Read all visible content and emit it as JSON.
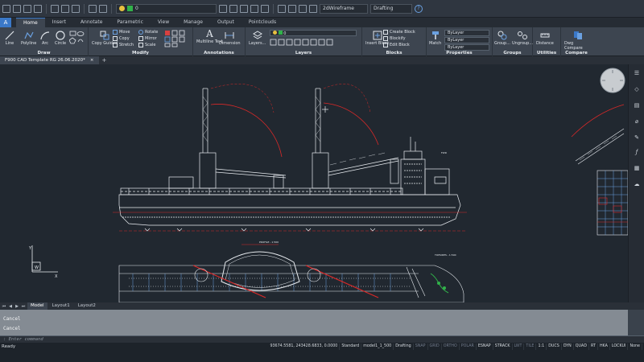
{
  "qat": {
    "layer_value": "0",
    "visual_style": "2dWireframe",
    "workspace": "Drafting"
  },
  "tabs": [
    "Home",
    "Insert",
    "Annotate",
    "Parametric",
    "View",
    "Manage",
    "Output",
    "Pointclouds"
  ],
  "ribbon": {
    "draw": {
      "title": "Draw",
      "line": "Line",
      "polyline": "Polyline",
      "arc": "Arc",
      "circle": "Circle"
    },
    "modify": {
      "title": "Modify",
      "copy_guided": "Copy Guided",
      "move": "Move",
      "copy": "Copy",
      "stretch": "Stretch",
      "rotate": "Rotate",
      "mirror": "Mirror",
      "scale": "Scale"
    },
    "annotations": {
      "title": "Annotations",
      "multiline_text": "Multiline Text",
      "dimension": "Dimension"
    },
    "layers": {
      "title": "Layers",
      "layers": "Layers...",
      "layer_value": "0"
    },
    "blocks": {
      "title": "Blocks",
      "insert_block": "Insert Block",
      "create_block": "Create Block",
      "blockify": "Blockify",
      "edit_block": "Edit Block"
    },
    "properties": {
      "title": "Properties",
      "match": "Match",
      "color": "ByLayer",
      "linetype": "ByLayer",
      "lineweight": "ByLayer"
    },
    "groups": {
      "title": "Groups",
      "group": "Group...",
      "ungroup": "Ungroup..."
    },
    "utilities": {
      "title": "Utilities",
      "distance": "Distance"
    },
    "compare": {
      "title": "Compare",
      "dwg_compare": "Dwg Compare"
    }
  },
  "document": {
    "tab_title": "F900 CAD Template RG 26.06.2020*",
    "close": "×",
    "new": "+"
  },
  "layout_tabs": [
    "Model",
    "Layout1",
    "Layout2"
  ],
  "command": {
    "history": [
      "Cancel",
      "Cancel"
    ],
    "prompt": ": Enter command"
  },
  "status": {
    "ready": "Ready",
    "coords": "93674.5581, 243428.6833, 0.0000",
    "items": [
      "Standard",
      "model1_1_500",
      "Drafting",
      "SNAP",
      "GRID",
      "ORTHO",
      "POLAR",
      "ESNAP",
      "STRACK",
      "LWT",
      "TILE",
      "1:1",
      "DUCS",
      "DYN",
      "QUAD",
      "RT",
      "HKA",
      "LOCKUI",
      "None"
    ],
    "off_items": [
      "SNAP",
      "GRID",
      "ORTHO",
      "POLAR",
      "LWT",
      "TILE"
    ]
  },
  "drawing": {
    "label_top_view": "TOPSIDES - 1:500",
    "label_profile": "PROFILE - 1:500"
  },
  "colors": {
    "accent": "#3a78c8",
    "drawing_bg": "#212830",
    "red_line": "#d82828",
    "white_line": "#e8ecf0"
  }
}
